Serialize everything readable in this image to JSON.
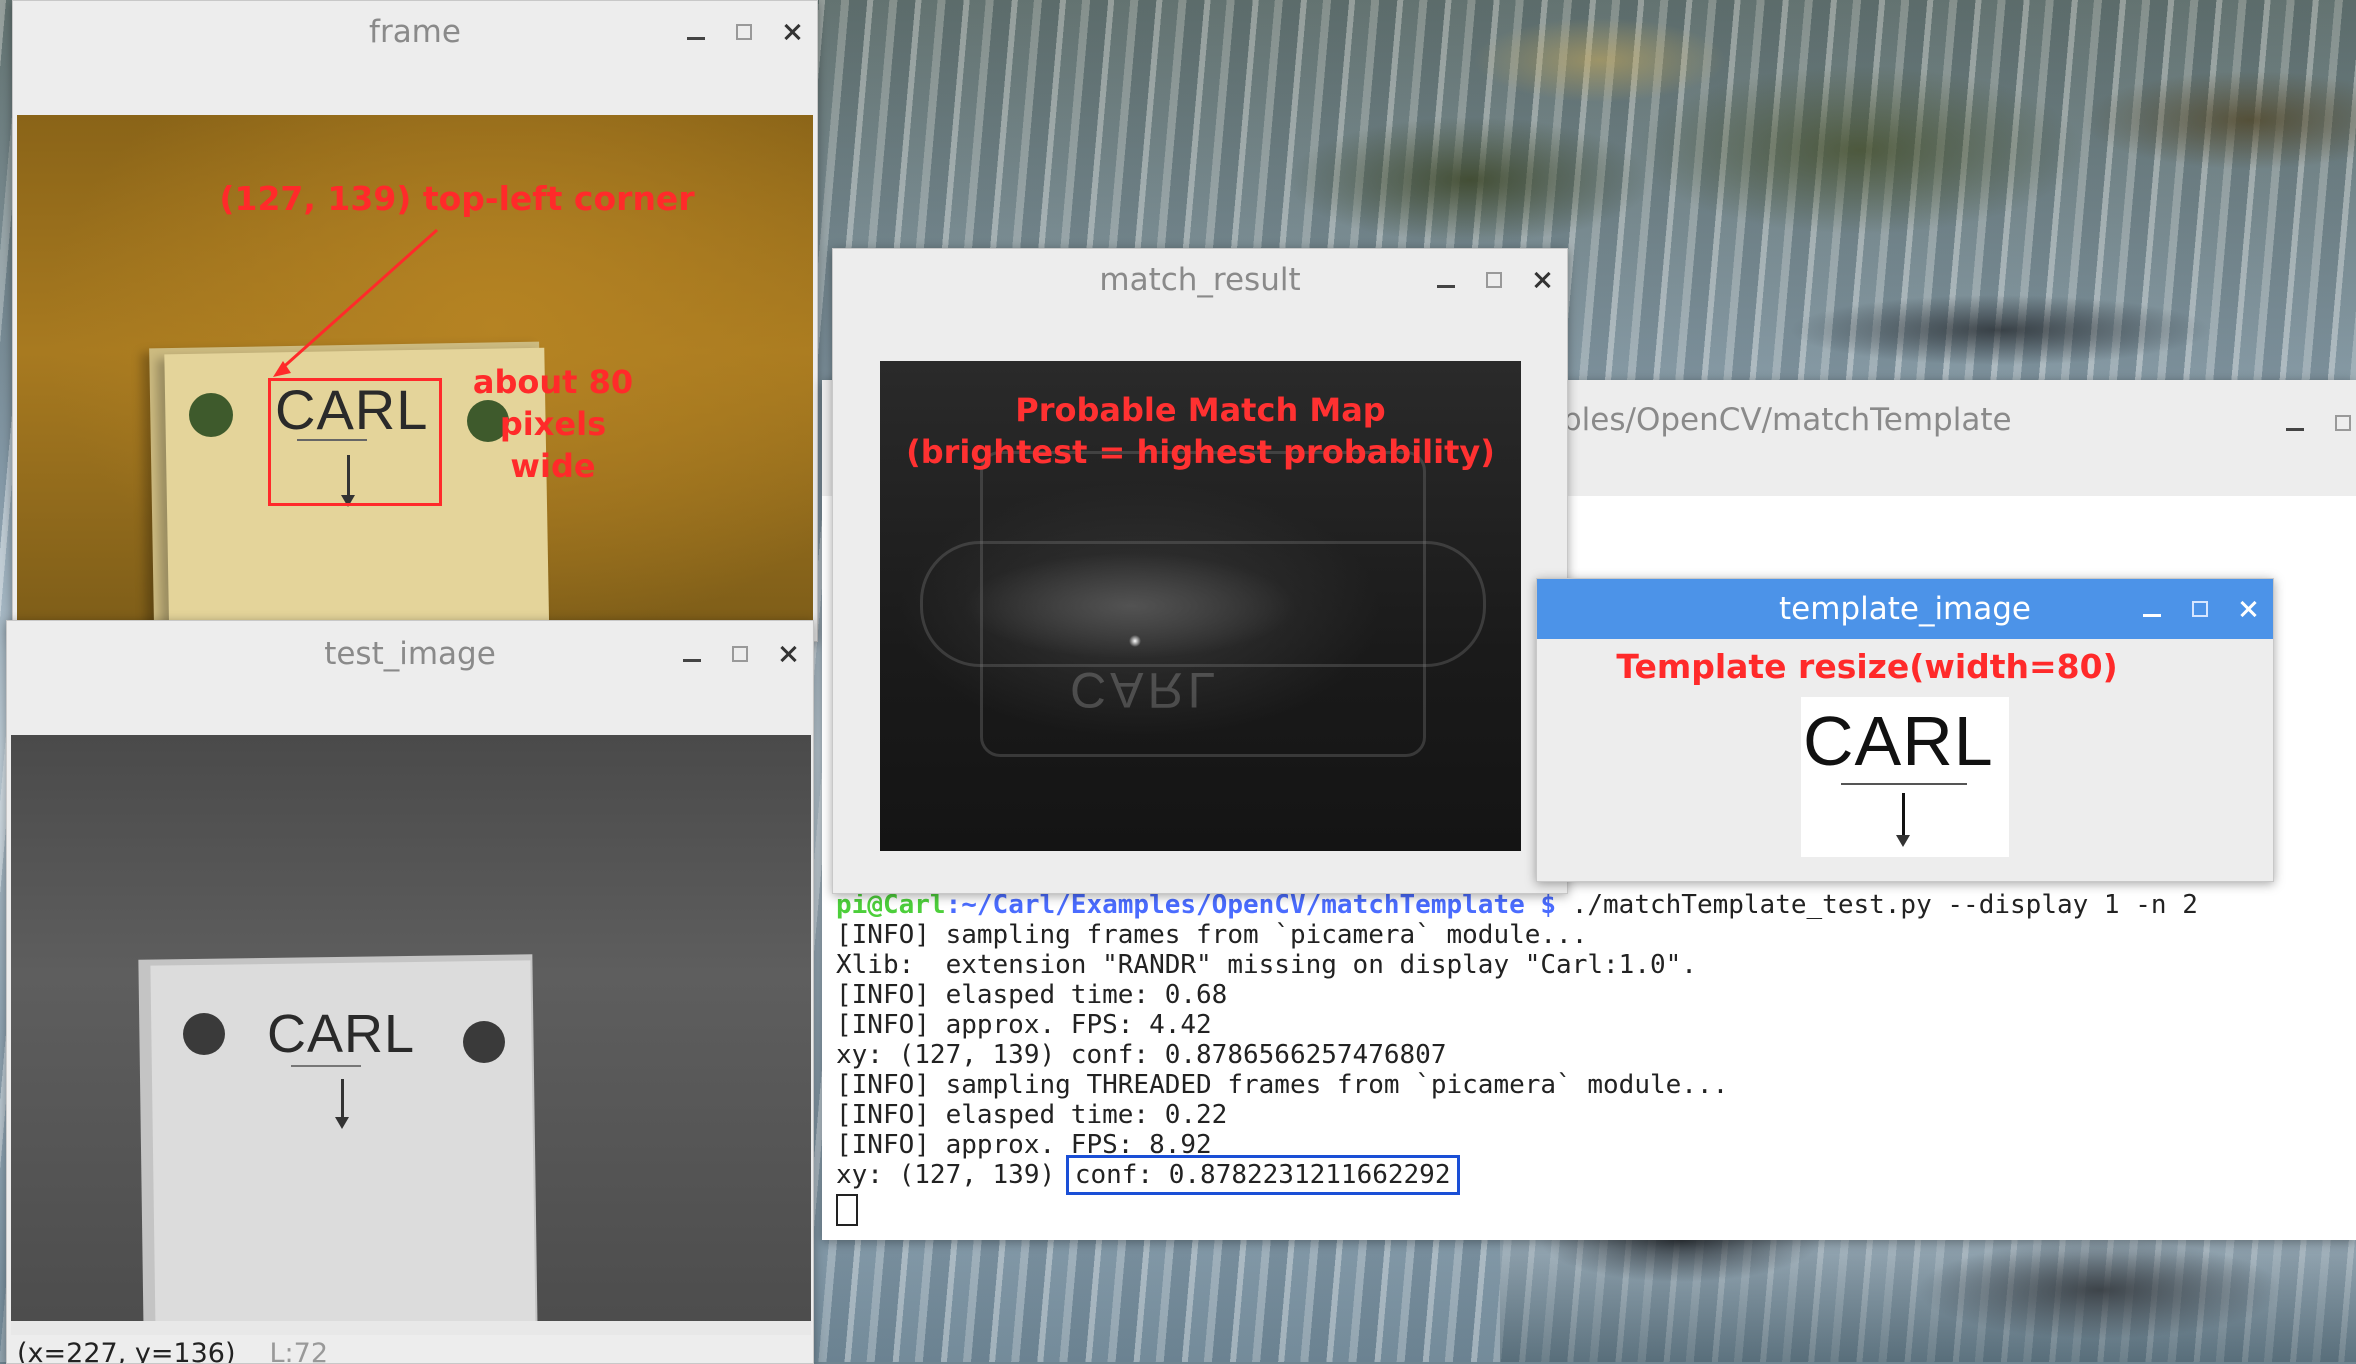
{
  "colors": {
    "annotation_red": "#ff2a2a",
    "terminal_user_green": "#4dcf3b",
    "terminal_path_blue": "#4a6cff",
    "active_titlebar_blue": "#4c93e8",
    "highlight_box_blue": "#1a4fd6"
  },
  "frame_window": {
    "title": "frame",
    "annotation_corner": "(127, 139) top-left corner",
    "annotation_width_line1": "about 80",
    "annotation_width_line2": "pixels",
    "annotation_width_line3": "wide",
    "card_text": "CARL"
  },
  "test_window": {
    "title": "test_image",
    "card_text": "CARL",
    "status_coords": "(x=227, y=136)",
    "status_value": "L:72"
  },
  "match_window": {
    "title": "match_result",
    "annotation_line1": "Probable Match Map",
    "annotation_line2": "(brightest = highest probability)"
  },
  "terminal_window": {
    "title": "ples/OpenCV/matchTemplate",
    "prompt_user": "pi@Carl",
    "prompt_path": ":~/Carl/Examples/OpenCV/matchTemplate $",
    "command": " ./matchTemplate_test.py --display 1 -n 2",
    "lines": [
      "[INFO] sampling frames from `picamera` module...",
      "Xlib:  extension \"RANDR\" missing on display \"Carl:1.0\".",
      "[INFO] elasped time: 0.68",
      "[INFO] approx. FPS: 4.42",
      "xy: (127, 139) conf: 0.8786566257476807",
      "[INFO] sampling THREADED frames from `picamera` module...",
      "[INFO] elasped time: 0.22",
      "[INFO] approx. FPS: 8.92"
    ],
    "last_line_prefix": "xy: (127, 139) ",
    "last_line_highlight": "conf: 0.8782231211662292"
  },
  "template_window": {
    "title": "template_image",
    "annotation": "Template resize(width=80)",
    "card_text": "CARL"
  },
  "icons": [
    "minimize-icon",
    "maximize-icon",
    "close-icon"
  ]
}
